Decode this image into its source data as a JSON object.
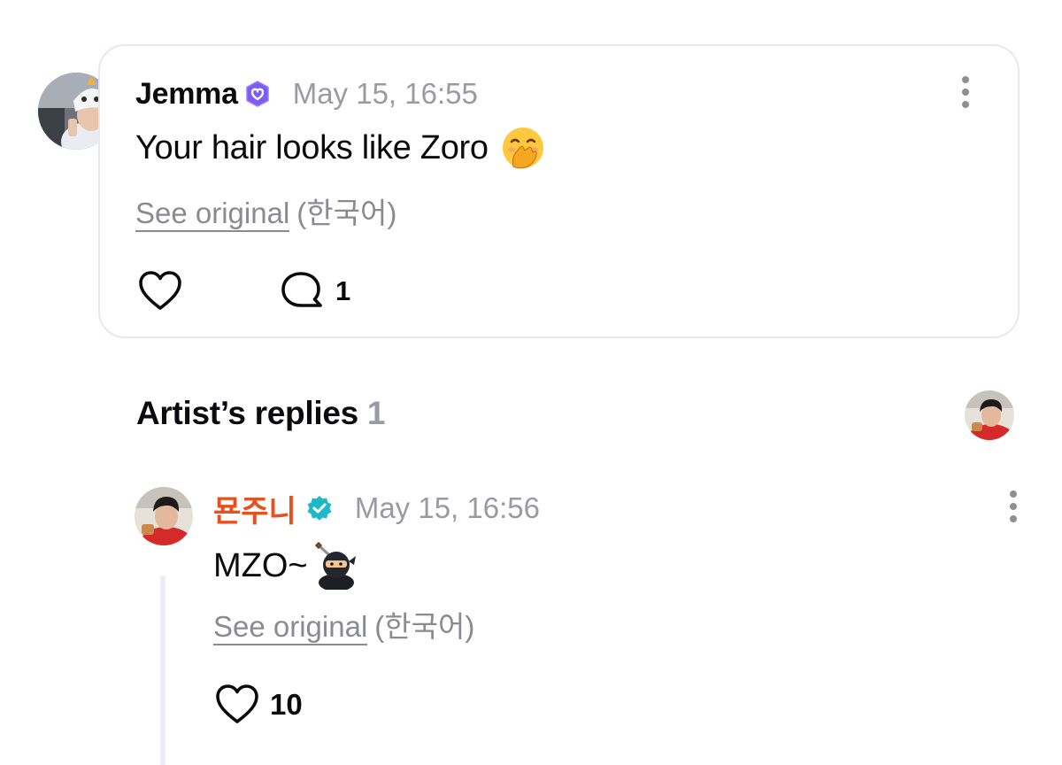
{
  "comment": {
    "author": "Jemma",
    "timestamp": "May 15, 16:55",
    "text": "Your hair looks like Zoro",
    "emoji_icon": "face-with-hand-over-mouth-icon",
    "see_original": "See original",
    "language": "(한국어)",
    "reply_count": "1"
  },
  "replies_section": {
    "title": "Artist’s replies",
    "count": "1"
  },
  "reply": {
    "author": "묜주니",
    "timestamp": "May 15, 16:56",
    "text": "MZO~",
    "emoji_icon": "ninja-icon",
    "see_original": "See original",
    "language": "(한국어)",
    "like_count": "10"
  },
  "colors": {
    "card_border": "#e8e6f5",
    "muted_text": "#9a9aa5",
    "artist_name": "#e8501e",
    "verified_purple": "#7b5cf5",
    "verified_teal": "#1fb8c9"
  }
}
